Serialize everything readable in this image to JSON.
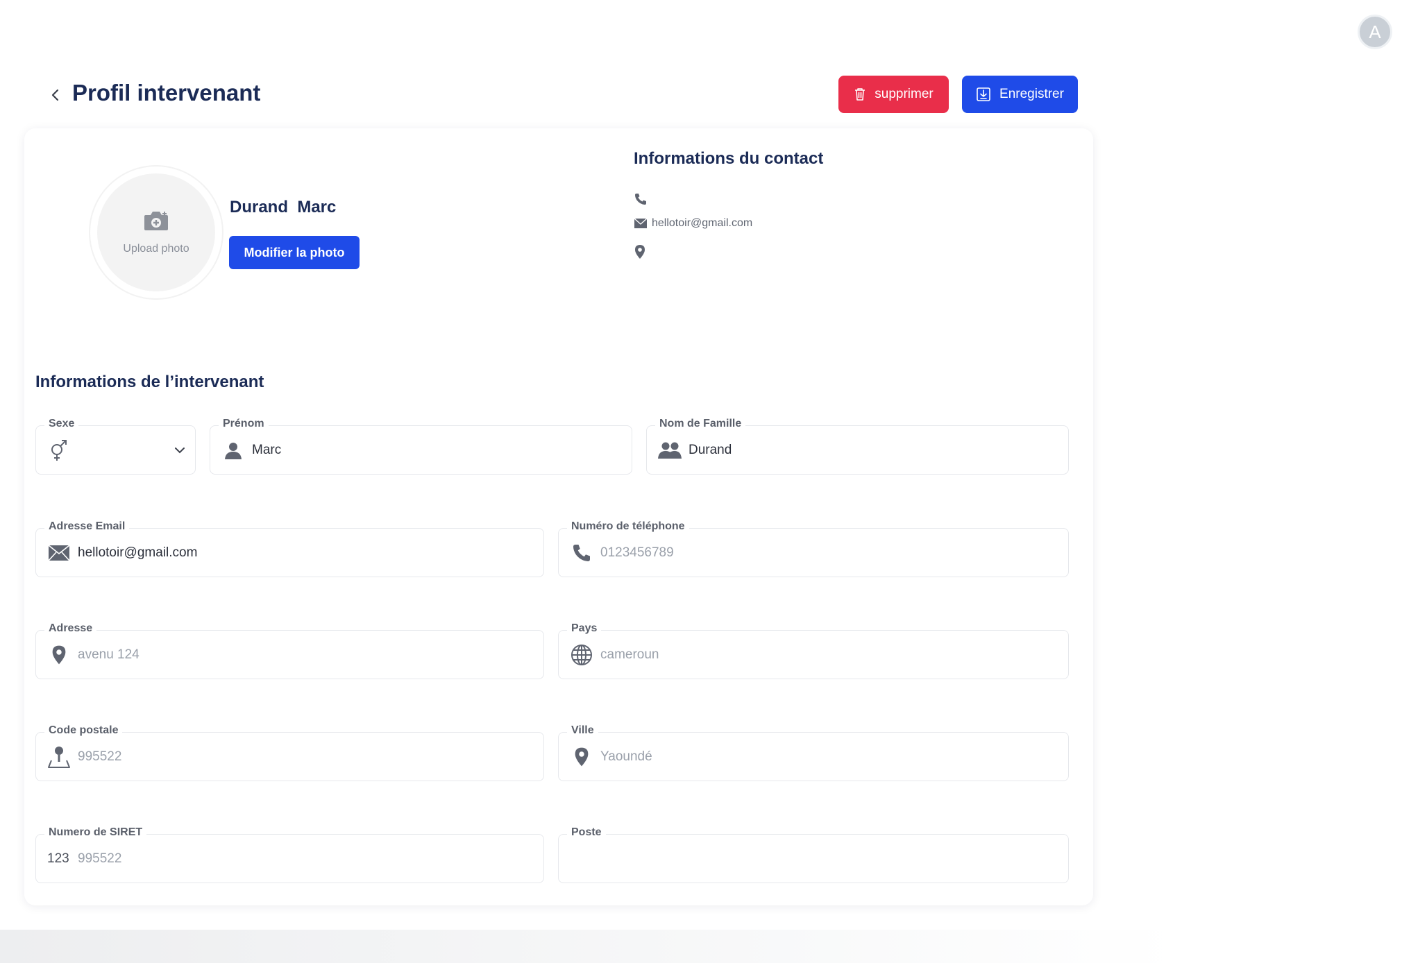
{
  "user_avatar": {
    "initial": "A"
  },
  "header": {
    "title": "Profil intervenant",
    "delete_label": "supprimer",
    "save_label": "Enregistrer"
  },
  "profile": {
    "upload_label": "Upload photo",
    "name": "Durand  Marc",
    "change_photo_label": "Modifier la photo"
  },
  "contact": {
    "title": "Informations du contact",
    "phone": "",
    "email": "hellotoir@gmail.com",
    "address": ""
  },
  "form": {
    "section_title": "Informations de l’intervenant",
    "sexe": {
      "label": "Sexe",
      "value": ""
    },
    "prenom": {
      "label": "Prénom",
      "value": "Marc"
    },
    "nom": {
      "label": "Nom de Famille",
      "value": "Durand"
    },
    "email": {
      "label": "Adresse Email",
      "value": "hellotoir@gmail.com"
    },
    "telephone": {
      "label": "Numéro de téléphone",
      "placeholder": "0123456789"
    },
    "adresse": {
      "label": "Adresse",
      "placeholder": "avenu 124"
    },
    "pays": {
      "label": "Pays",
      "placeholder": "cameroun"
    },
    "code_postal": {
      "label": "Code postale",
      "placeholder": "995522"
    },
    "ville": {
      "label": "Ville",
      "placeholder": "Yaoundé"
    },
    "siret": {
      "label": "Numero de SIRET",
      "prefix": "123",
      "placeholder": "995522"
    },
    "poste": {
      "label": "Poste",
      "value": ""
    }
  },
  "colors": {
    "primary": "#1f4be8",
    "danger": "#e92e4a",
    "title": "#1b2b56"
  }
}
